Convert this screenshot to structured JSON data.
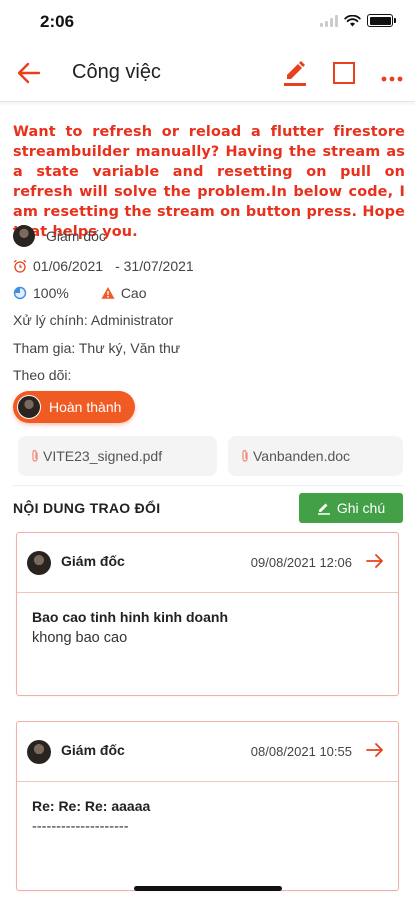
{
  "status_bar": {
    "time": "2:06"
  },
  "app_bar": {
    "title": "Công việc",
    "back_icon": "arrow-left-icon",
    "edit_icon": "pencil-icon",
    "square_icon": "square-icon",
    "more_icon": "more-horizontal-icon",
    "accent_color": "#e8401c"
  },
  "task": {
    "title": "Want to refresh or reload a flutter firestore streambuilder manually? Having the stream as a state variable and resetting on pull on refresh will solve the problem.In below code, I am resetting the stream on button press. Hope that helps you.",
    "creator": "Giám đốc",
    "start_date": "01/06/2021",
    "end_date": "- 31/07/2021",
    "progress": "100%",
    "priority": "Cao",
    "main_handler": "Xử lý chính: Administrator",
    "participants": "Tham gia: Thư ký, Văn thư",
    "followers": "Theo dõi:",
    "status": "Hoàn thành"
  },
  "attachments": [
    {
      "name": "VITE23_signed.pdf"
    },
    {
      "name": "Vanbanden.doc"
    }
  ],
  "discussion": {
    "section_title": "NỘI DUNG TRAO ĐỔI",
    "note_button": "Ghi chú",
    "note_button_color": "#43a047",
    "comments": [
      {
        "author": "Giám đốc",
        "time": "09/08/2021 12:06",
        "subject": "Bao cao tinh hinh kinh doanh",
        "text": "khong bao cao"
      },
      {
        "author": "Giám đốc",
        "time": "08/08/2021 10:55",
        "subject": "Re: Re: Re: aaaaa",
        "text": "--------------------"
      }
    ]
  }
}
